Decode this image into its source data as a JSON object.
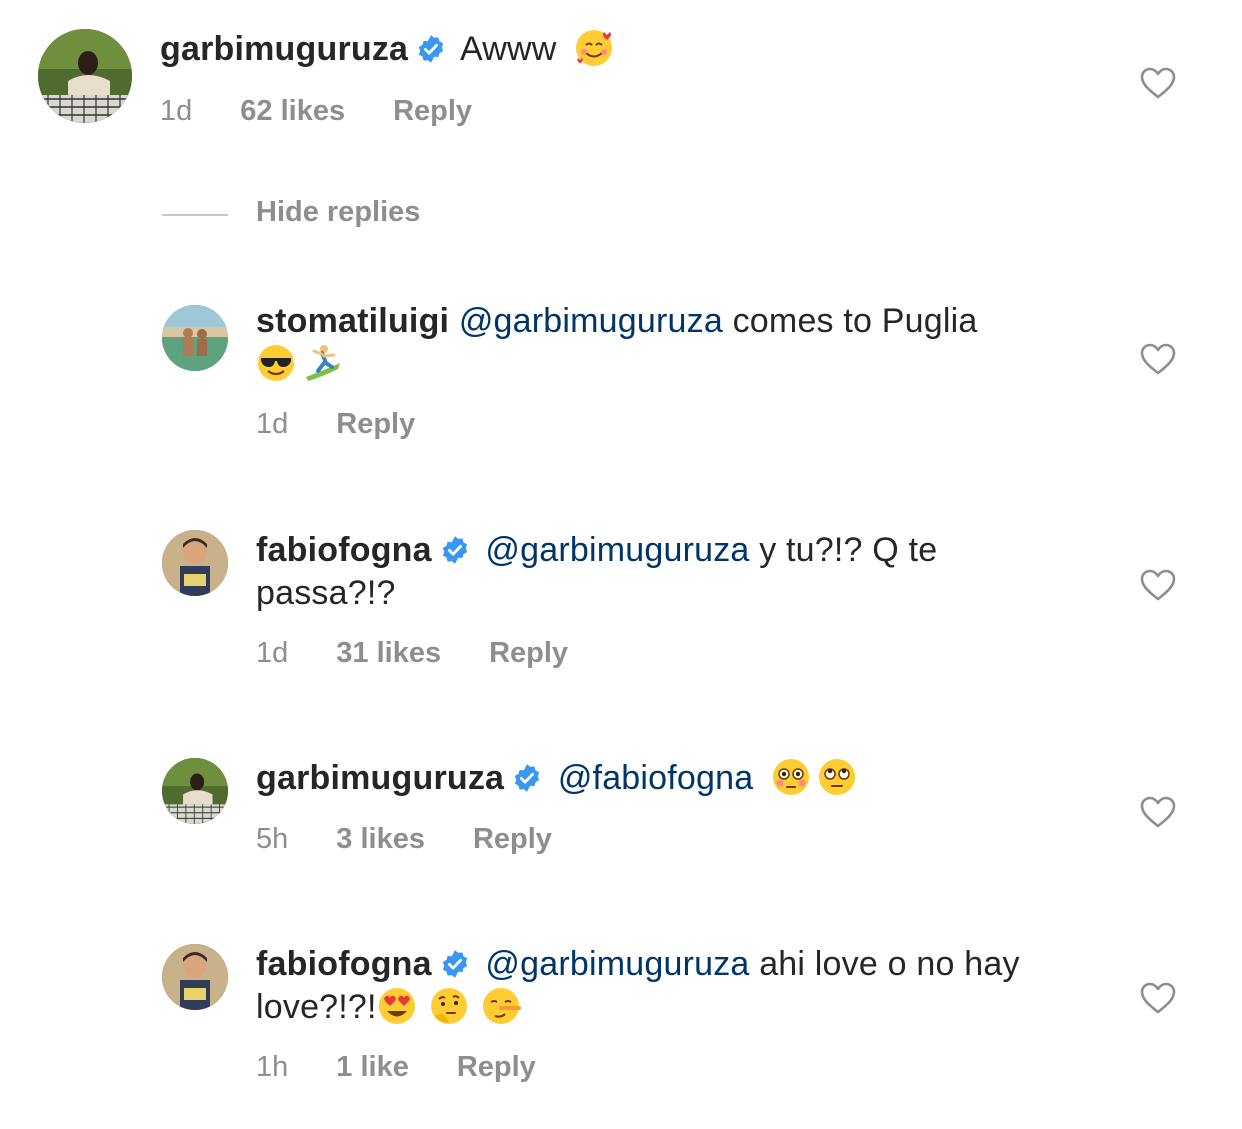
{
  "top_comment": {
    "username": "garbimuguruza",
    "text": "Awww",
    "emojis": [
      "smiling-face-with-hearts"
    ],
    "time": "1d",
    "likes": "62 likes",
    "reply": "Reply"
  },
  "hide_replies": "Hide replies",
  "replies": [
    {
      "username": "stomatiluigi",
      "verified": false,
      "mention": "@garbimuguruza",
      "text": "comes to Puglia",
      "emojis": [
        "smiling-face-with-sunglasses",
        "person-surfing"
      ],
      "time": "1d",
      "likes": "",
      "reply": "Reply"
    },
    {
      "username": "fabiofogna",
      "verified": true,
      "mention": "@garbimuguruza",
      "text": "y tu?!? Q te passa?!?",
      "emojis": [],
      "time": "1d",
      "likes": "31 likes",
      "reply": "Reply"
    },
    {
      "username": "garbimuguruza",
      "verified": true,
      "mention": "@fabiofogna",
      "text": "",
      "emojis": [
        "flushed-face",
        "rolling-eyes-face"
      ],
      "time": "5h",
      "likes": "3 likes",
      "reply": "Reply"
    },
    {
      "username": "fabiofogna",
      "verified": true,
      "mention": "@garbimuguruza",
      "text": "ahi love o no hay love?!?!",
      "emojis": [
        "heart-eyes-face",
        "thinking-face",
        "lying-face"
      ],
      "time": "1h",
      "likes": "1 like",
      "reply": "Reply"
    }
  ],
  "colors": {
    "username": "#262626",
    "mention": "#003569",
    "meta": "#8e8e8e",
    "verified": "#3897f0"
  }
}
